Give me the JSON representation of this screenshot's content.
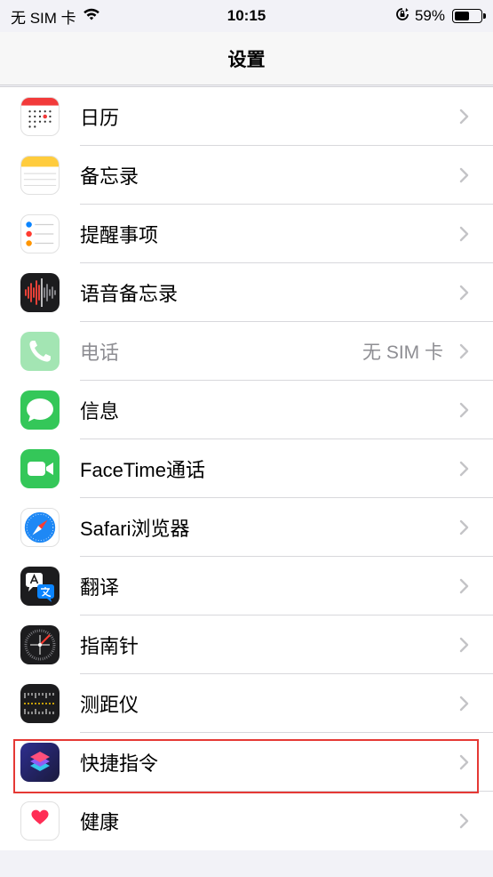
{
  "status_bar": {
    "carrier": "无 SIM 卡",
    "time": "10:15",
    "battery_percent": "59%",
    "battery_level": 0.59,
    "icons": [
      "wifi-icon",
      "orientation-lock-icon",
      "battery-icon"
    ]
  },
  "nav": {
    "title": "设置"
  },
  "rows": [
    {
      "id": "calendar",
      "label": "日历",
      "icon": "calendar-icon"
    },
    {
      "id": "notes",
      "label": "备忘录",
      "icon": "notes-icon"
    },
    {
      "id": "reminders",
      "label": "提醒事项",
      "icon": "reminders-icon"
    },
    {
      "id": "voice-memos",
      "label": "语音备忘录",
      "icon": "voice-memos-icon"
    },
    {
      "id": "phone",
      "label": "电话",
      "detail": "无 SIM 卡",
      "icon": "phone-icon",
      "dimmed": true
    },
    {
      "id": "messages",
      "label": "信息",
      "icon": "messages-icon"
    },
    {
      "id": "facetime",
      "label": "FaceTime通话",
      "icon": "facetime-icon"
    },
    {
      "id": "safari",
      "label": "Safari浏览器",
      "icon": "safari-icon"
    },
    {
      "id": "translate",
      "label": "翻译",
      "icon": "translate-icon"
    },
    {
      "id": "compass",
      "label": "指南针",
      "icon": "compass-icon"
    },
    {
      "id": "measure",
      "label": "测距仪",
      "icon": "measure-icon"
    },
    {
      "id": "shortcuts",
      "label": "快捷指令",
      "icon": "shortcuts-icon",
      "highlighted": true
    },
    {
      "id": "health",
      "label": "健康",
      "icon": "health-icon"
    }
  ],
  "colors": {
    "highlight_border": "#e53935",
    "secondary_text": "#8e8e93",
    "messages_green": "#34c759",
    "calendar_red": "#f23a3a"
  }
}
